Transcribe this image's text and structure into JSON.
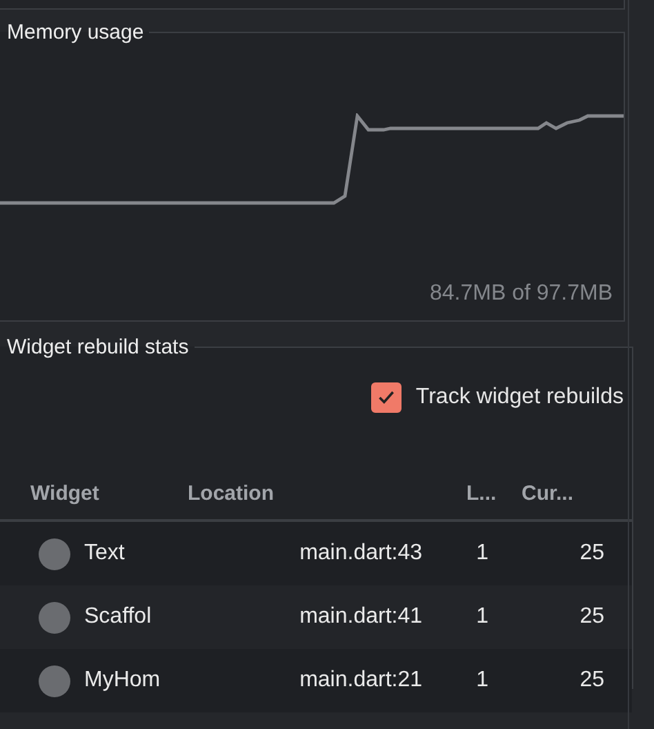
{
  "memory_panel": {
    "title": "Memory usage",
    "reading": "84.7MB of 97.7MB"
  },
  "rebuild_panel": {
    "title": "Widget rebuild stats",
    "track_rebuilds": {
      "label": "Track widget rebuilds",
      "checked": true
    },
    "table": {
      "columns": [
        "Widget",
        "Location",
        "L...",
        "Cur..."
      ],
      "rows": [
        {
          "widget": "Text",
          "location": "main.dart:43",
          "last": "1",
          "current": "25"
        },
        {
          "widget": "Scaffol",
          "location": "main.dart:41",
          "last": "1",
          "current": "25"
        },
        {
          "widget": "MyHom",
          "location": "main.dart:21",
          "last": "1",
          "current": "25"
        }
      ]
    }
  }
}
